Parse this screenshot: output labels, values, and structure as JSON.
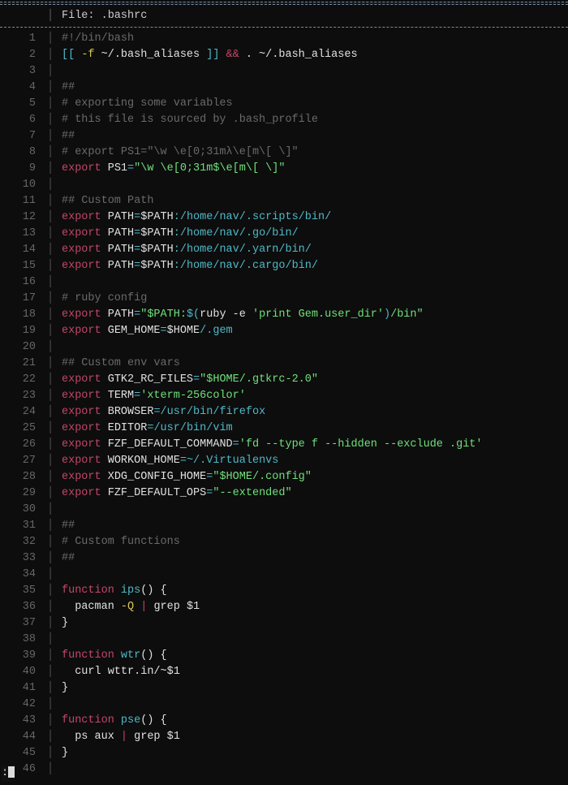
{
  "header": {
    "file_label": "File: .bashrc"
  },
  "status": {
    "prompt": ":"
  },
  "lines": [
    {
      "n": 1,
      "tokens": [
        {
          "t": "#!/bin/bash",
          "c": "c-comment"
        }
      ]
    },
    {
      "n": 2,
      "tokens": [
        {
          "t": "[[ ",
          "c": "c-punct"
        },
        {
          "t": "-f",
          "c": "c-yellow"
        },
        {
          "t": " ~/.bash_aliases ",
          "c": "c-white"
        },
        {
          "t": "]]",
          "c": "c-punct"
        },
        {
          "t": " && ",
          "c": "c-amp"
        },
        {
          "t": ". ~/.bash_aliases",
          "c": "c-white"
        }
      ]
    },
    {
      "n": 3,
      "tokens": []
    },
    {
      "n": 4,
      "tokens": [
        {
          "t": "##",
          "c": "c-comment"
        }
      ]
    },
    {
      "n": 5,
      "tokens": [
        {
          "t": "# exporting some variables",
          "c": "c-comment"
        }
      ]
    },
    {
      "n": 6,
      "tokens": [
        {
          "t": "# this file is sourced by .bash_profile",
          "c": "c-comment"
        }
      ]
    },
    {
      "n": 7,
      "tokens": [
        {
          "t": "##",
          "c": "c-comment"
        }
      ]
    },
    {
      "n": 8,
      "tokens": [
        {
          "t": "# export PS1=\"\\w \\e[0;31mλ\\e[m\\[ \\]\"",
          "c": "c-comment"
        }
      ]
    },
    {
      "n": 9,
      "tokens": [
        {
          "t": "export",
          "c": "c-keyword"
        },
        {
          "t": " ",
          "c": ""
        },
        {
          "t": "PS1",
          "c": "c-var"
        },
        {
          "t": "=",
          "c": "c-eq"
        },
        {
          "t": "\"\\w \\e[0;31m$\\e[m\\[ \\]\"",
          "c": "c-string"
        }
      ]
    },
    {
      "n": 10,
      "tokens": []
    },
    {
      "n": 11,
      "tokens": [
        {
          "t": "## Custom Path",
          "c": "c-comment"
        }
      ]
    },
    {
      "n": 12,
      "tokens": [
        {
          "t": "export",
          "c": "c-keyword"
        },
        {
          "t": " ",
          "c": ""
        },
        {
          "t": "PATH",
          "c": "c-var"
        },
        {
          "t": "=",
          "c": "c-eq"
        },
        {
          "t": "$PATH",
          "c": "c-var"
        },
        {
          "t": ":/home/nav/.scripts/bin/",
          "c": "c-path"
        }
      ]
    },
    {
      "n": 13,
      "tokens": [
        {
          "t": "export",
          "c": "c-keyword"
        },
        {
          "t": " ",
          "c": ""
        },
        {
          "t": "PATH",
          "c": "c-var"
        },
        {
          "t": "=",
          "c": "c-eq"
        },
        {
          "t": "$PATH",
          "c": "c-var"
        },
        {
          "t": ":/home/nav/.go/bin/",
          "c": "c-path"
        }
      ]
    },
    {
      "n": 14,
      "tokens": [
        {
          "t": "export",
          "c": "c-keyword"
        },
        {
          "t": " ",
          "c": ""
        },
        {
          "t": "PATH",
          "c": "c-var"
        },
        {
          "t": "=",
          "c": "c-eq"
        },
        {
          "t": "$PATH",
          "c": "c-var"
        },
        {
          "t": ":/home/nav/.yarn/bin/",
          "c": "c-path"
        }
      ]
    },
    {
      "n": 15,
      "tokens": [
        {
          "t": "export",
          "c": "c-keyword"
        },
        {
          "t": " ",
          "c": ""
        },
        {
          "t": "PATH",
          "c": "c-var"
        },
        {
          "t": "=",
          "c": "c-eq"
        },
        {
          "t": "$PATH",
          "c": "c-var"
        },
        {
          "t": ":/home/nav/.cargo/bin/",
          "c": "c-path"
        }
      ]
    },
    {
      "n": 16,
      "tokens": []
    },
    {
      "n": 17,
      "tokens": [
        {
          "t": "# ruby config",
          "c": "c-comment"
        }
      ]
    },
    {
      "n": 18,
      "tokens": [
        {
          "t": "export",
          "c": "c-keyword"
        },
        {
          "t": " ",
          "c": ""
        },
        {
          "t": "PATH",
          "c": "c-var"
        },
        {
          "t": "=",
          "c": "c-eq"
        },
        {
          "t": "\"$PATH:",
          "c": "c-string"
        },
        {
          "t": "$(",
          "c": "c-path"
        },
        {
          "t": "ruby -e ",
          "c": "c-white"
        },
        {
          "t": "'print Gem.user_dir'",
          "c": "c-string"
        },
        {
          "t": ")",
          "c": "c-path"
        },
        {
          "t": "/bin\"",
          "c": "c-string"
        }
      ]
    },
    {
      "n": 19,
      "tokens": [
        {
          "t": "export",
          "c": "c-keyword"
        },
        {
          "t": " ",
          "c": ""
        },
        {
          "t": "GEM_HOME",
          "c": "c-var"
        },
        {
          "t": "=",
          "c": "c-eq"
        },
        {
          "t": "$HOME",
          "c": "c-var"
        },
        {
          "t": "/.gem",
          "c": "c-path"
        }
      ]
    },
    {
      "n": 20,
      "tokens": []
    },
    {
      "n": 21,
      "tokens": [
        {
          "t": "## Custom env vars",
          "c": "c-comment"
        }
      ]
    },
    {
      "n": 22,
      "tokens": [
        {
          "t": "export",
          "c": "c-keyword"
        },
        {
          "t": " ",
          "c": ""
        },
        {
          "t": "GTK2_RC_FILES",
          "c": "c-var"
        },
        {
          "t": "=",
          "c": "c-eq"
        },
        {
          "t": "\"$HOME/.gtkrc-2.0\"",
          "c": "c-string"
        }
      ]
    },
    {
      "n": 23,
      "tokens": [
        {
          "t": "export",
          "c": "c-keyword"
        },
        {
          "t": " ",
          "c": ""
        },
        {
          "t": "TERM",
          "c": "c-var"
        },
        {
          "t": "=",
          "c": "c-eq"
        },
        {
          "t": "'xterm-256color'",
          "c": "c-string"
        }
      ]
    },
    {
      "n": 24,
      "tokens": [
        {
          "t": "export",
          "c": "c-keyword"
        },
        {
          "t": " ",
          "c": ""
        },
        {
          "t": "BROWSER",
          "c": "c-var"
        },
        {
          "t": "=",
          "c": "c-eq"
        },
        {
          "t": "/usr/bin/firefox",
          "c": "c-path"
        }
      ]
    },
    {
      "n": 25,
      "tokens": [
        {
          "t": "export",
          "c": "c-keyword"
        },
        {
          "t": " ",
          "c": ""
        },
        {
          "t": "EDITOR",
          "c": "c-var"
        },
        {
          "t": "=",
          "c": "c-eq"
        },
        {
          "t": "/usr/bin/vim",
          "c": "c-path"
        }
      ]
    },
    {
      "n": 26,
      "tokens": [
        {
          "t": "export",
          "c": "c-keyword"
        },
        {
          "t": " ",
          "c": ""
        },
        {
          "t": "FZF_DEFAULT_COMMAND",
          "c": "c-var"
        },
        {
          "t": "=",
          "c": "c-eq"
        },
        {
          "t": "'fd --type f --hidden --exclude .git'",
          "c": "c-string"
        }
      ]
    },
    {
      "n": 27,
      "tokens": [
        {
          "t": "export",
          "c": "c-keyword"
        },
        {
          "t": " ",
          "c": ""
        },
        {
          "t": "WORKON_HOME",
          "c": "c-var"
        },
        {
          "t": "=",
          "c": "c-eq"
        },
        {
          "t": "~/.Virtualenvs",
          "c": "c-path"
        }
      ]
    },
    {
      "n": 28,
      "tokens": [
        {
          "t": "export",
          "c": "c-keyword"
        },
        {
          "t": " ",
          "c": ""
        },
        {
          "t": "XDG_CONFIG_HOME",
          "c": "c-var"
        },
        {
          "t": "=",
          "c": "c-eq"
        },
        {
          "t": "\"$HOME/.config\"",
          "c": "c-string"
        }
      ]
    },
    {
      "n": 29,
      "tokens": [
        {
          "t": "export",
          "c": "c-keyword"
        },
        {
          "t": " ",
          "c": ""
        },
        {
          "t": "FZF_DEFAULT_OPS",
          "c": "c-var"
        },
        {
          "t": "=",
          "c": "c-eq"
        },
        {
          "t": "\"--extended\"",
          "c": "c-string"
        }
      ]
    },
    {
      "n": 30,
      "tokens": []
    },
    {
      "n": 31,
      "tokens": [
        {
          "t": "##",
          "c": "c-comment"
        }
      ]
    },
    {
      "n": 32,
      "tokens": [
        {
          "t": "# Custom functions",
          "c": "c-comment"
        }
      ]
    },
    {
      "n": 33,
      "tokens": [
        {
          "t": "##",
          "c": "c-comment"
        }
      ]
    },
    {
      "n": 34,
      "tokens": []
    },
    {
      "n": 35,
      "tokens": [
        {
          "t": "function",
          "c": "c-keyword"
        },
        {
          "t": " ",
          "c": ""
        },
        {
          "t": "ips",
          "c": "c-fnname"
        },
        {
          "t": "() {",
          "c": "c-white"
        }
      ]
    },
    {
      "n": 36,
      "tokens": [
        {
          "t": "  pacman ",
          "c": "c-white"
        },
        {
          "t": "-Q",
          "c": "c-yellow"
        },
        {
          "t": " | ",
          "c": "c-amp"
        },
        {
          "t": "grep ",
          "c": "c-white"
        },
        {
          "t": "$1",
          "c": "c-var"
        }
      ]
    },
    {
      "n": 37,
      "tokens": [
        {
          "t": "}",
          "c": "c-white"
        }
      ]
    },
    {
      "n": 38,
      "tokens": []
    },
    {
      "n": 39,
      "tokens": [
        {
          "t": "function",
          "c": "c-keyword"
        },
        {
          "t": " ",
          "c": ""
        },
        {
          "t": "wtr",
          "c": "c-fnname"
        },
        {
          "t": "() {",
          "c": "c-white"
        }
      ]
    },
    {
      "n": 40,
      "tokens": [
        {
          "t": "  curl wttr.in/~",
          "c": "c-white"
        },
        {
          "t": "$1",
          "c": "c-var"
        }
      ]
    },
    {
      "n": 41,
      "tokens": [
        {
          "t": "}",
          "c": "c-white"
        }
      ]
    },
    {
      "n": 42,
      "tokens": []
    },
    {
      "n": 43,
      "tokens": [
        {
          "t": "function",
          "c": "c-keyword"
        },
        {
          "t": " ",
          "c": ""
        },
        {
          "t": "pse",
          "c": "c-fnname"
        },
        {
          "t": "() {",
          "c": "c-white"
        }
      ]
    },
    {
      "n": 44,
      "tokens": [
        {
          "t": "  ps aux ",
          "c": "c-white"
        },
        {
          "t": "| ",
          "c": "c-amp"
        },
        {
          "t": "grep ",
          "c": "c-white"
        },
        {
          "t": "$1",
          "c": "c-var"
        }
      ]
    },
    {
      "n": 45,
      "tokens": [
        {
          "t": "}",
          "c": "c-white"
        }
      ]
    },
    {
      "n": 46,
      "tokens": []
    }
  ]
}
